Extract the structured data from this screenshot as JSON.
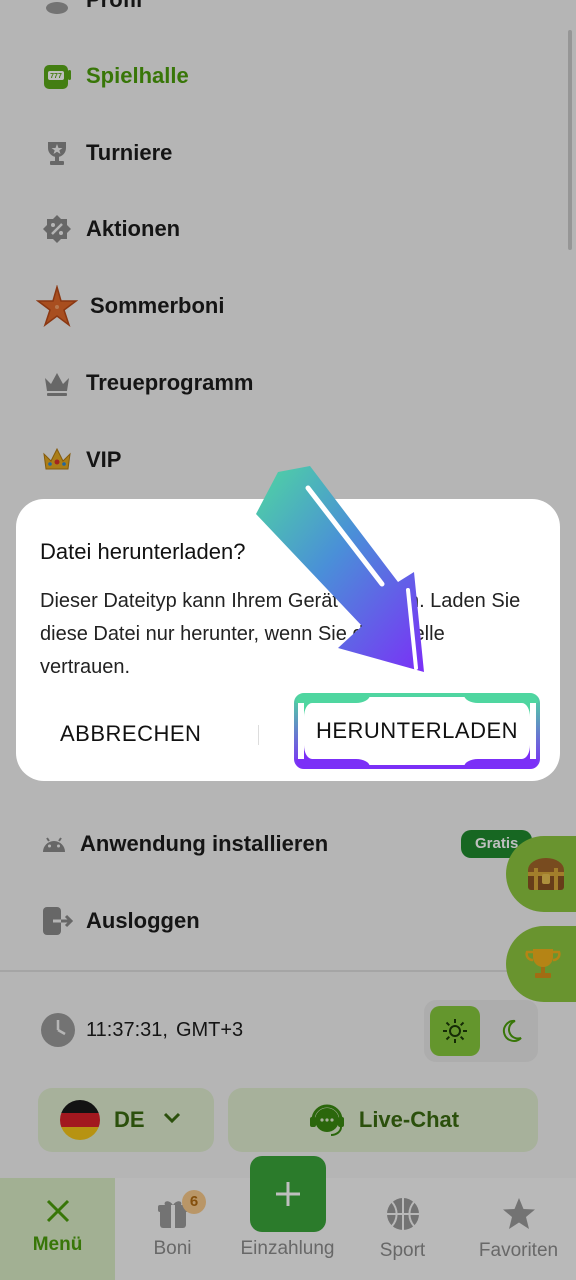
{
  "menu": {
    "items": [
      {
        "label": "Profil"
      },
      {
        "label": "Spielhalle"
      },
      {
        "label": "Turniere"
      },
      {
        "label": "Aktionen"
      },
      {
        "label": "Sommerboni"
      },
      {
        "label": "Treueprogramm"
      },
      {
        "label": "VIP"
      },
      {
        "label": "Anwendung installieren"
      },
      {
        "label": "Ausloggen"
      }
    ],
    "gratis_badge": "Gratis"
  },
  "clock": {
    "time": "11:37:31,",
    "timezone": "GMT+3"
  },
  "language": {
    "code": "DE"
  },
  "chat": {
    "label": "Live-Chat"
  },
  "bottom_nav": {
    "items": [
      {
        "label": "Menü"
      },
      {
        "label": "Boni",
        "badge": "6"
      },
      {
        "label": "Einzahlung"
      },
      {
        "label": "Sport"
      },
      {
        "label": "Favoriten"
      }
    ]
  },
  "dialog": {
    "title": "Datei herunterladen?",
    "body": "Dieser Dateityp kann Ihrem Gerät schaden. Laden Sie diese Datei nur herunter, wenn Sie der Quelle vertrauen.",
    "cancel_label": "ABBRECHEN",
    "download_label": "HERUNTERLADEN"
  },
  "colors": {
    "accent_green": "#4b9e0b",
    "gratis_green": "#1f8a2e",
    "arrow_start": "#4fd6a0",
    "arrow_end": "#7b2ff7"
  }
}
